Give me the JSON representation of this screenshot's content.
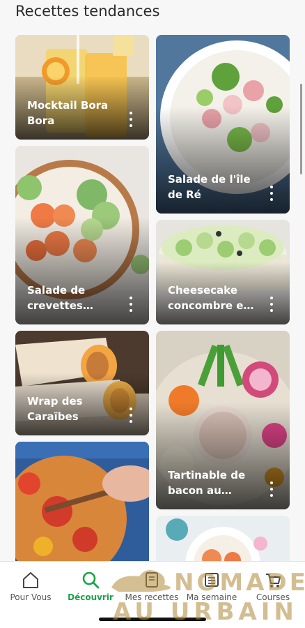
{
  "section": {
    "title": "Recettes tendances"
  },
  "recipes": {
    "left": [
      {
        "title": "Mocktail Bora Bora"
      },
      {
        "title": "Salade de crevettes…"
      },
      {
        "title": "Wrap des Caraïbes"
      },
      {
        "title": ""
      }
    ],
    "right": [
      {
        "title": "Salade de l'île de Ré"
      },
      {
        "title": "Cheesecake concombre e…"
      },
      {
        "title": "Tartinable de bacon au…"
      },
      {
        "title": ""
      }
    ]
  },
  "tabbar": {
    "items": [
      {
        "label": "Pour Vous",
        "icon": "home-icon"
      },
      {
        "label": "Découvrir",
        "icon": "search-icon"
      },
      {
        "label": "Mes recettes",
        "icon": "book-icon"
      },
      {
        "label": "Ma semaine",
        "icon": "calendar-list-icon"
      },
      {
        "label": "Courses",
        "icon": "cart-icon"
      }
    ],
    "active_color": "#1ba34a"
  },
  "watermark": {
    "line1": "NOMADE",
    "line2": "AU URBAIN"
  }
}
